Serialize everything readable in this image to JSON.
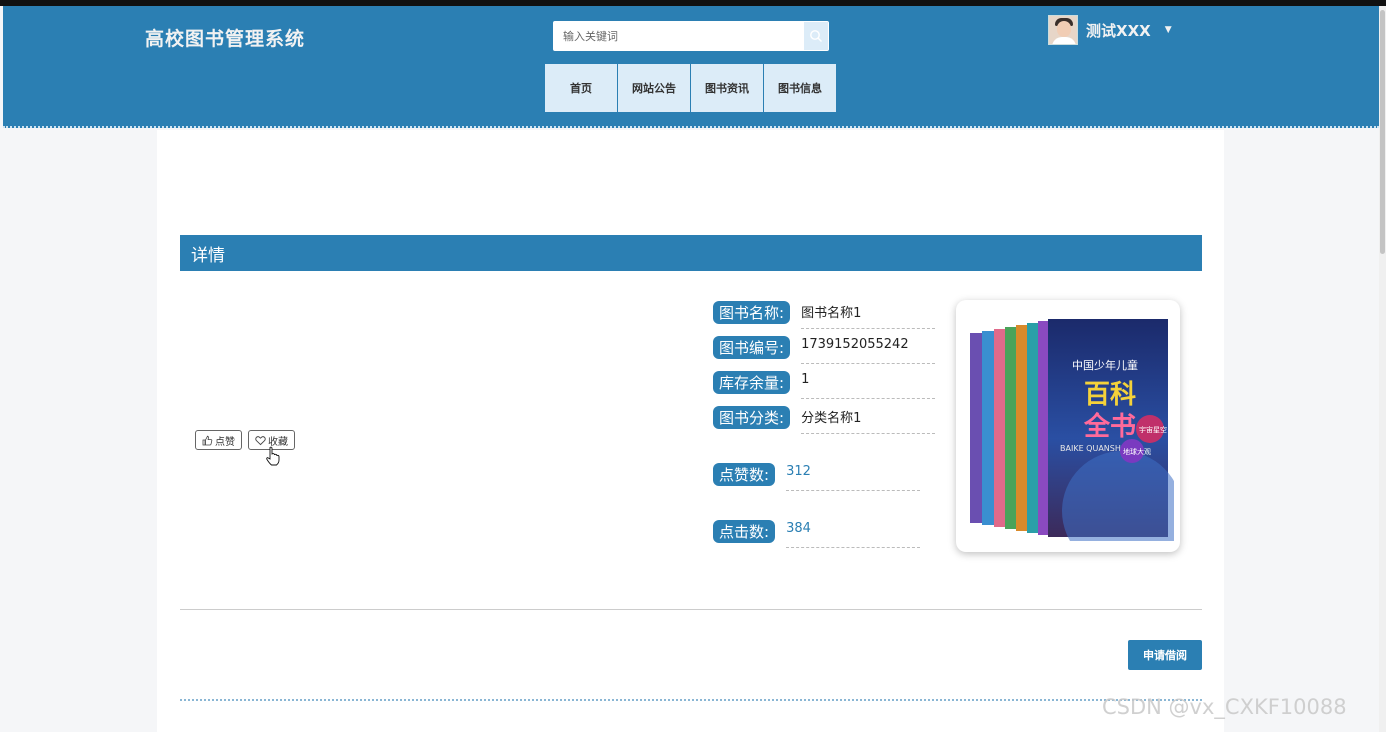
{
  "header": {
    "site_title": "高校图书管理系统",
    "search_placeholder": "输入关键词",
    "user_name": "测试XXX",
    "nav": [
      "首页",
      "网站公告",
      "图书资讯",
      "图书信息"
    ]
  },
  "section": {
    "title": "详情"
  },
  "actions": {
    "like": "点赞",
    "favorite": "收藏"
  },
  "book": {
    "fields": [
      {
        "label": "图书名称:",
        "value": "图书名称1"
      },
      {
        "label": "图书编号:",
        "value": "1739152055242"
      },
      {
        "label": "库存余量:",
        "value": "1"
      },
      {
        "label": "图书分类:",
        "value": "分类名称1"
      }
    ],
    "likes_label": "点赞数:",
    "likes_value": "312",
    "clicks_label": "点击数:",
    "clicks_value": "384",
    "cover_texts": {
      "big1": "百科",
      "big2": "全书",
      "sub": "中国少年儿童",
      "pinyin": "BAIKE QUANSHU",
      "badge1": "宇宙星空",
      "badge2": "地球大观"
    }
  },
  "apply_button": "申请借阅",
  "watermark": "CSDN @vx_CXKF10088",
  "colors": {
    "primary": "#2b7fb3",
    "nav_bg": "#dcecf8"
  }
}
